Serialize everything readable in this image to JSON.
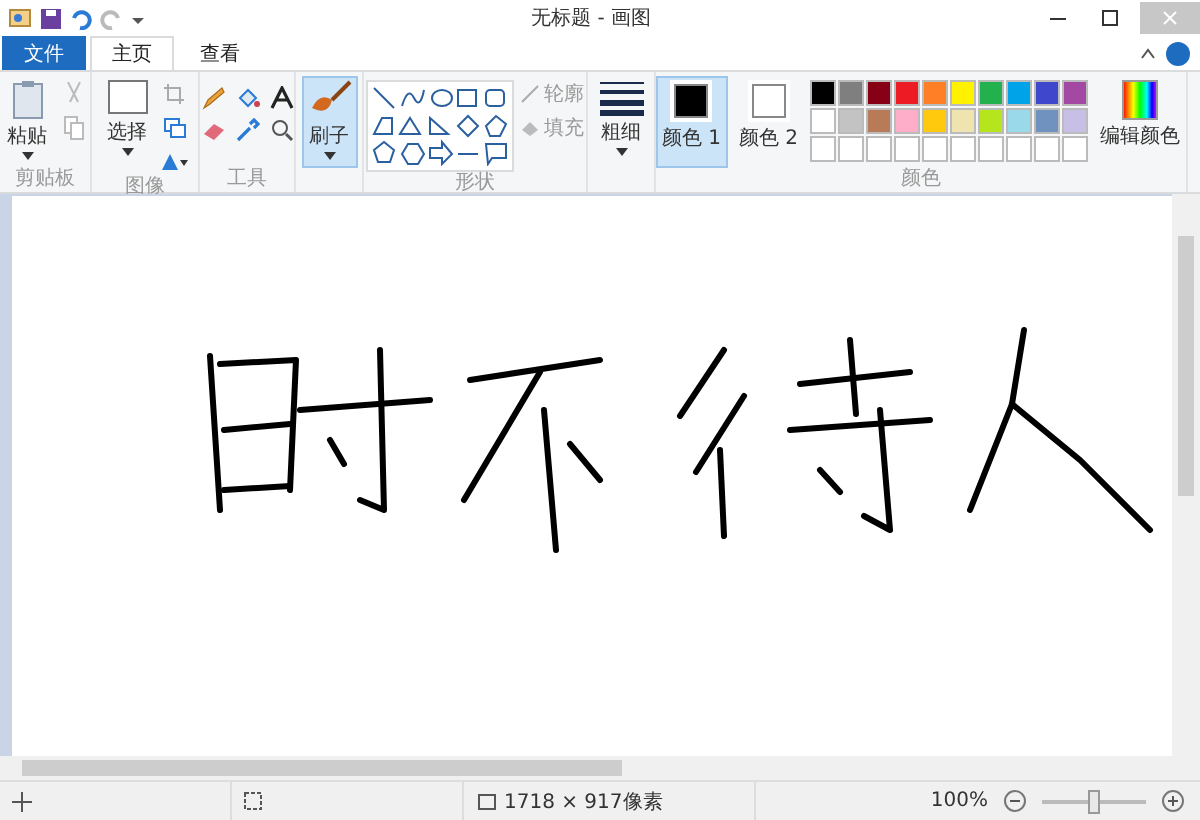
{
  "window": {
    "title": "无标题 - 画图"
  },
  "tabs": [
    {
      "label": "文件",
      "kind": "file",
      "selected": false
    },
    {
      "label": "主页",
      "kind": "tab",
      "selected": true
    },
    {
      "label": "查看",
      "kind": "tab",
      "selected": false
    }
  ],
  "ribbon": {
    "clipboard": {
      "paste": "粘贴",
      "label": "剪贴板"
    },
    "image": {
      "select": "选择",
      "label": "图像"
    },
    "tools": {
      "label": "工具"
    },
    "brush": {
      "label": "刷子",
      "selected": true
    },
    "shapes": {
      "outline": "轮廓",
      "fill": "填充",
      "label": "形状"
    },
    "size": {
      "label": "粗细"
    },
    "colors": {
      "label": "颜色",
      "edit": "编辑颜色",
      "active": [
        {
          "label": "颜色 1",
          "color": "#000000",
          "selected": true
        },
        {
          "label": "颜色 2",
          "color": "#ffffff",
          "selected": false
        }
      ],
      "palette": [
        {
          "color": "#000000"
        },
        {
          "color": "#7f7f7f"
        },
        {
          "color": "#880015"
        },
        {
          "color": "#ed1c24"
        },
        {
          "color": "#ff7f27"
        },
        {
          "color": "#fff200"
        },
        {
          "color": "#22b14c"
        },
        {
          "color": "#00a2e8"
        },
        {
          "color": "#3f48cc"
        },
        {
          "color": "#a349a4"
        },
        {
          "color": "#ffffff"
        },
        {
          "color": "#c3c3c3"
        },
        {
          "color": "#b97a57"
        },
        {
          "color": "#ffaec9"
        },
        {
          "color": "#ffc90e"
        },
        {
          "color": "#efe4b0"
        },
        {
          "color": "#b5e61d"
        },
        {
          "color": "#99d9ea"
        },
        {
          "color": "#7092be"
        },
        {
          "color": "#c8bfe7"
        }
      ]
    }
  },
  "status_bar": {
    "dimensions": "1718 × 917像素",
    "zoom": "100%",
    "zoom_slider": {
      "level": 0.5
    }
  }
}
